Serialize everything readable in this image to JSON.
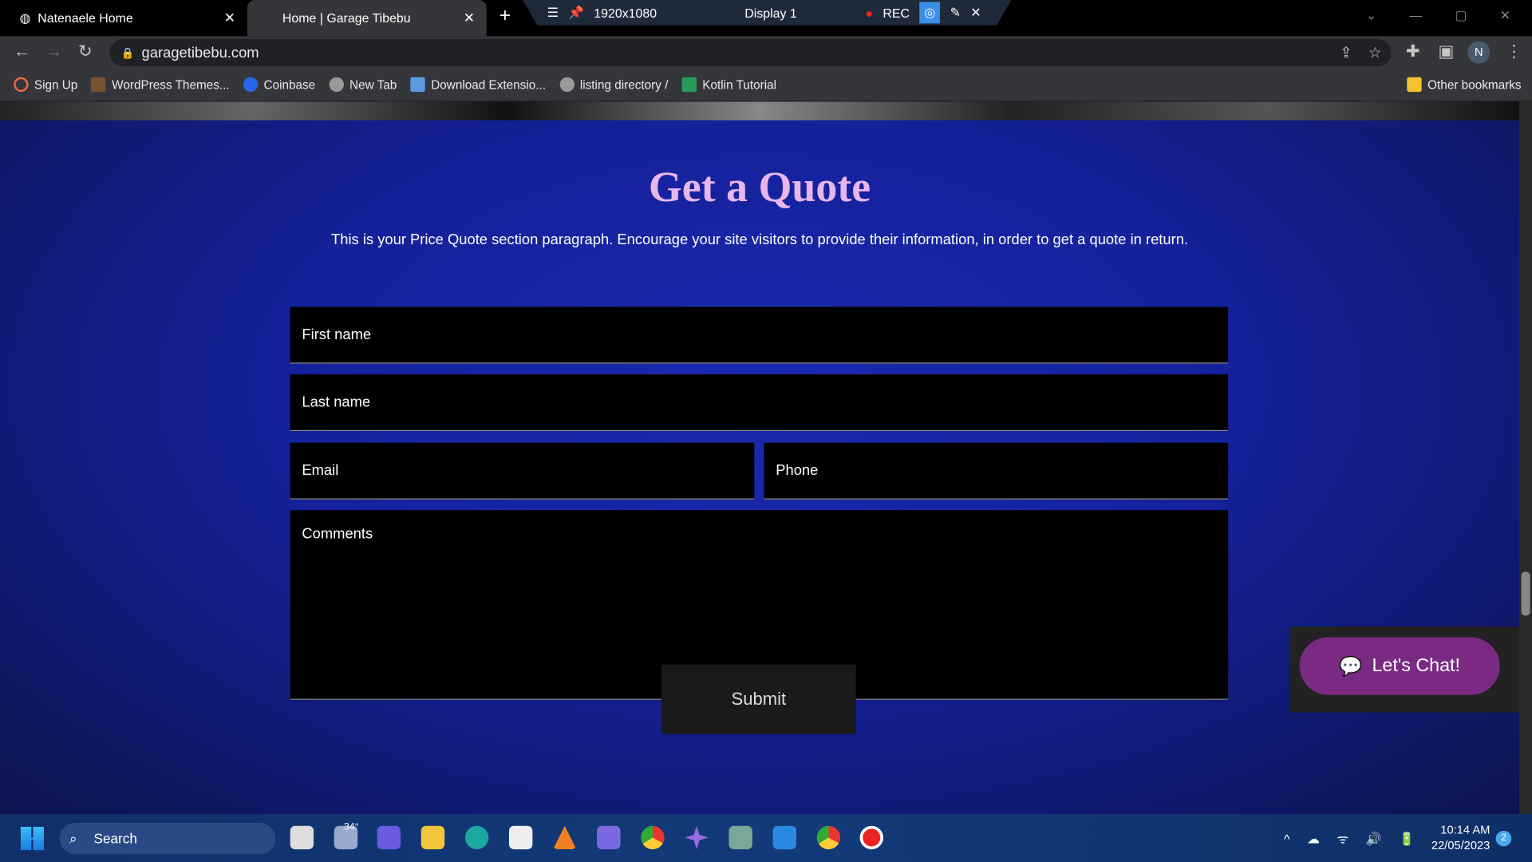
{
  "browser": {
    "tabs": [
      {
        "title": "Natenaele Home",
        "active": false
      },
      {
        "title": "Home | Garage Tibebu",
        "active": true
      }
    ],
    "url": "garagetibebu.com",
    "profile": "N",
    "recorder": {
      "resolution": "1920x1080",
      "display": "Display 1",
      "rec": "REC"
    },
    "bookmarks": [
      "Sign Up",
      "WordPress Themes...",
      "Coinbase",
      "New Tab",
      "Download Extensio...",
      "listing directory /",
      "Kotlin Tutorial"
    ],
    "other_bookmarks": "Other bookmarks"
  },
  "page": {
    "title": "Get a Quote",
    "paragraph": "This is your Price Quote section paragraph. Encourage your site visitors to provide their information, in order to get a quote in return.",
    "form": {
      "first_name": "First name",
      "last_name": "Last name",
      "email": "Email",
      "phone": "Phone",
      "comments": "Comments",
      "submit": "Submit"
    },
    "chat": "Let's Chat!",
    "accent": "#e7b6ea"
  },
  "taskbar": {
    "search": "Search",
    "weather": "34°",
    "time": "10:14 AM",
    "date": "22/05/2023",
    "notifications": "2"
  }
}
